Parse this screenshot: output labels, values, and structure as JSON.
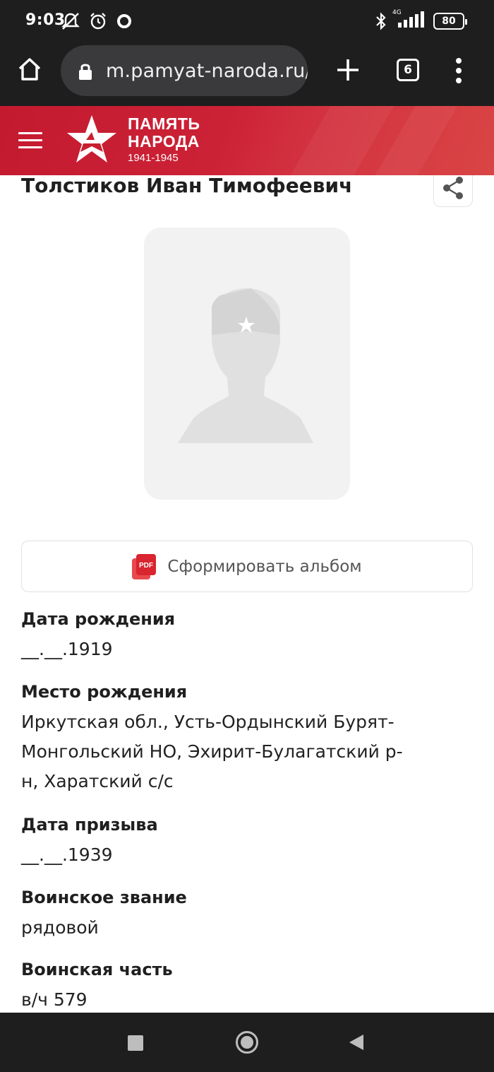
{
  "status_bar": {
    "time": "9:03",
    "network": "4G",
    "battery": "80"
  },
  "browser": {
    "url": "m.pamyat-naroda.ru/heroes",
    "tab_count": "6"
  },
  "site_header": {
    "logo_line1": "ПАМЯТЬ",
    "logo_line2": "НАРОДА",
    "logo_years": "1941-1945",
    "brand_color": "#c8202f"
  },
  "person": {
    "name": "Толстиков Иван Тимофеевич"
  },
  "album_button": {
    "label": "Сформировать альбом",
    "icon": "pdf-icon"
  },
  "fields": [
    {
      "label": "Дата рождения",
      "value": "__.__.1919"
    },
    {
      "label": "Место рождения",
      "value": "Иркутская обл., Усть-Ордынский Бурят-Монгольский НО, Эхирит-Булагатский р-н, Харатский с/с"
    },
    {
      "label": "Дата призыва",
      "value": "__.__.1939"
    },
    {
      "label": "Воинское звание",
      "value": "рядовой"
    },
    {
      "label": "Воинская часть",
      "value": "в/ч 579"
    }
  ],
  "nav_icons": [
    "recents-icon",
    "home-icon",
    "back-icon"
  ]
}
